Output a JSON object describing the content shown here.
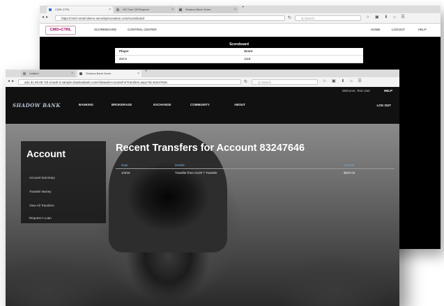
{
  "back_window": {
    "tabs": [
      {
        "label": "CWE-CTRL"
      },
      {
        "label": "HE Time Off Request"
      },
      {
        "label": "Shadow Bank Home"
      }
    ],
    "url": "https://cntrl.nmntrl.demo.securityinnovation.com/scoreboard",
    "search_placeholder": "Q Search",
    "logo_text": "CMD+CTRL",
    "nav": {
      "scoreboard": "SCOREBOARD",
      "control_center": "CONTROL CENTER"
    },
    "right_nav": {
      "home": "HOME",
      "logout": "LOGOUT",
      "help": "HELP"
    },
    "scoreboard": {
      "title": "Scoreboard",
      "headers": {
        "player": "Player",
        "score": "Score"
      },
      "rows": [
        {
          "player": "demo",
          "score": "1118"
        }
      ]
    }
  },
  "front_window": {
    "tabs": [
      {
        "label": "Untitled"
      },
      {
        "label": "Shadow Bank Home"
      }
    ],
    "url": "ad1.d1.00.00.*10.sl.web-3.sample.shadowbank.com/AllowedAccountsForTransfers.aspx?id=83247646",
    "search_placeholder": "Q Search",
    "welcome": "Welcome, Test User",
    "help": "HELP",
    "logo": "SHADOW BANK",
    "nav": [
      "BANKING",
      "BROKERAGE",
      "EXCHANGE",
      "COMMUNITY",
      "ABOUT"
    ],
    "logout": "LOG OUT",
    "sidebar": {
      "title": "Account",
      "links": [
        "Account Summary",
        "Transfer Money",
        "View All Transfers",
        "Request A Loan"
      ]
    },
    "main": {
      "title": "Recent Transfers for Account 83247646",
      "headers": {
        "date": "Date",
        "details": "Details",
        "amount": "Amount"
      },
      "rows": [
        {
          "date": "1/4/16",
          "details": "Transfer from Acct# 7 Transfer",
          "amount": "$500.00"
        }
      ]
    }
  },
  "colors": {
    "header_bg": "#111111",
    "link_blue": "#7fb0e0",
    "logo_blue": "#b9c4d8"
  }
}
